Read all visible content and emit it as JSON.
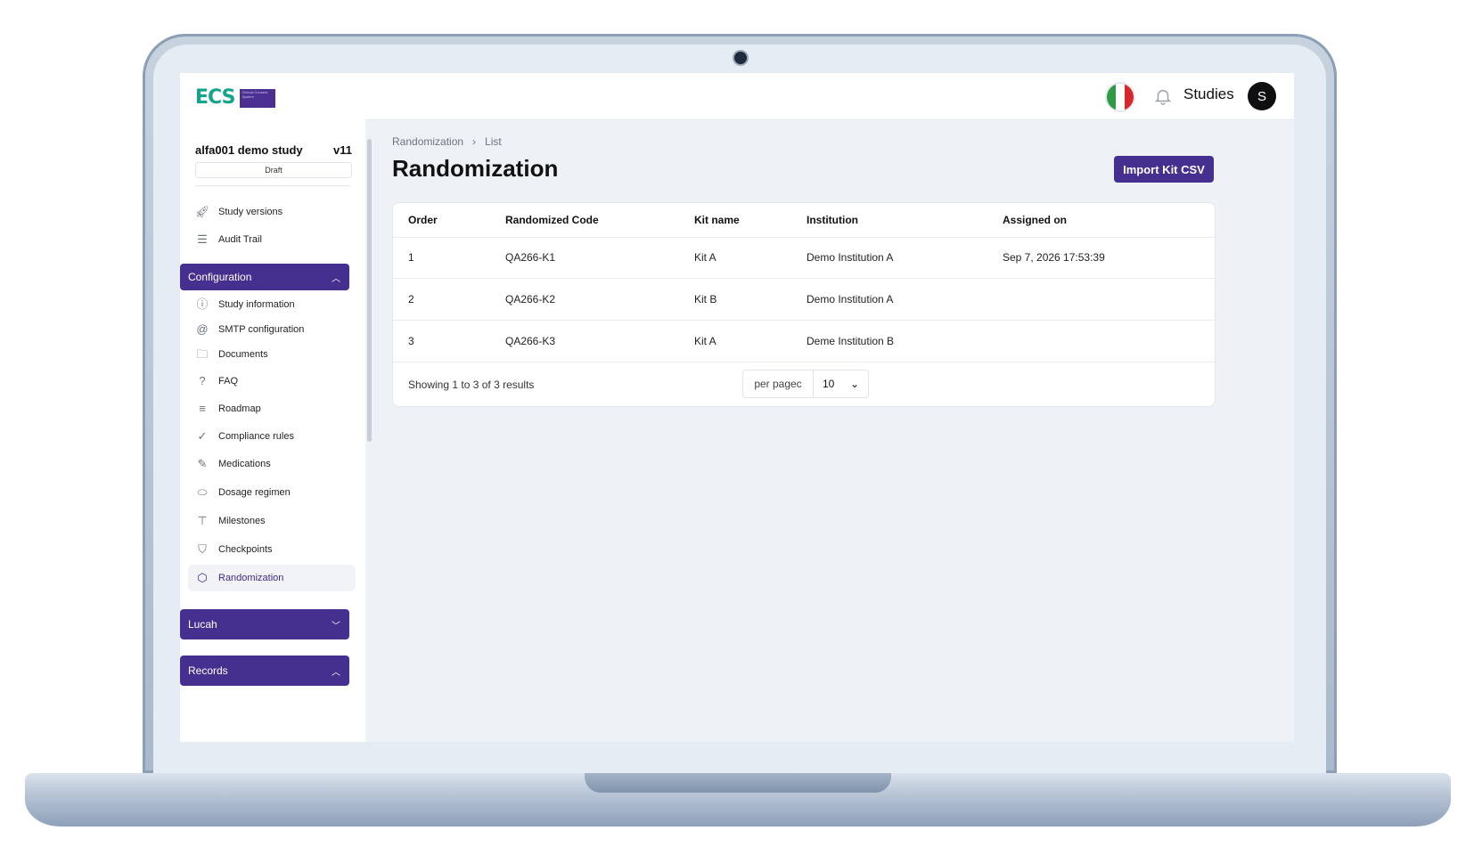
{
  "header": {
    "app": "ECS",
    "app_sub": "Clinical Consent System",
    "studies_label": "Studies",
    "avatar_initial": "S"
  },
  "study": {
    "name": "alfa001 demo study",
    "version": "v11",
    "status": "Draft"
  },
  "sidebar": {
    "top_items": [
      {
        "label": "Study versions",
        "icon": "rocket-icon"
      },
      {
        "label": "Audit Trail",
        "icon": "list-icon"
      }
    ],
    "configuration": {
      "label": "Configuration",
      "items": [
        {
          "label": "Study information",
          "icon": "info-icon"
        },
        {
          "label": "SMTP configuration",
          "icon": "at-icon"
        },
        {
          "label": "Documents",
          "icon": "folder-icon"
        },
        {
          "label": "FAQ",
          "icon": "question-icon"
        },
        {
          "label": "Roadmap",
          "icon": "roadmap-icon"
        },
        {
          "label": "Compliance rules",
          "icon": "badge-check-icon"
        },
        {
          "label": "Medications",
          "icon": "syringe-icon"
        },
        {
          "label": "Dosage regimen",
          "icon": "pill-icon"
        },
        {
          "label": "Milestones",
          "icon": "signpost-icon"
        },
        {
          "label": "Checkpoints",
          "icon": "bookmark-icon"
        },
        {
          "label": "Randomization",
          "icon": "cube-icon"
        }
      ]
    },
    "lucah": {
      "label": "Lucah"
    },
    "records": {
      "label": "Records"
    }
  },
  "breadcrumb": {
    "first": "Randomization",
    "second": "List"
  },
  "page_title": "Randomization",
  "import_button": "Import Kit CSV",
  "table": {
    "headers": [
      "Order",
      "Randomized Code",
      "Kit name",
      "Institution",
      "Assigned on"
    ],
    "rows": [
      [
        "1",
        "QA266-K1",
        "Kit A",
        "Demo Institution A",
        "Sep 7, 2026 17:53:39"
      ],
      [
        "2",
        "QA266-K2",
        "Kit B",
        "Demo Institution A",
        ""
      ],
      [
        "3",
        "QA266-K3",
        "Kit A",
        "Deme Institution B",
        ""
      ]
    ]
  },
  "pagination": {
    "summary": "Showing 1 to 3 of 3 results",
    "per_page_label": "per pagec",
    "per_page_value": "10"
  },
  "colors": {
    "primary": "#45308f",
    "accent_green": "#14a38b"
  }
}
